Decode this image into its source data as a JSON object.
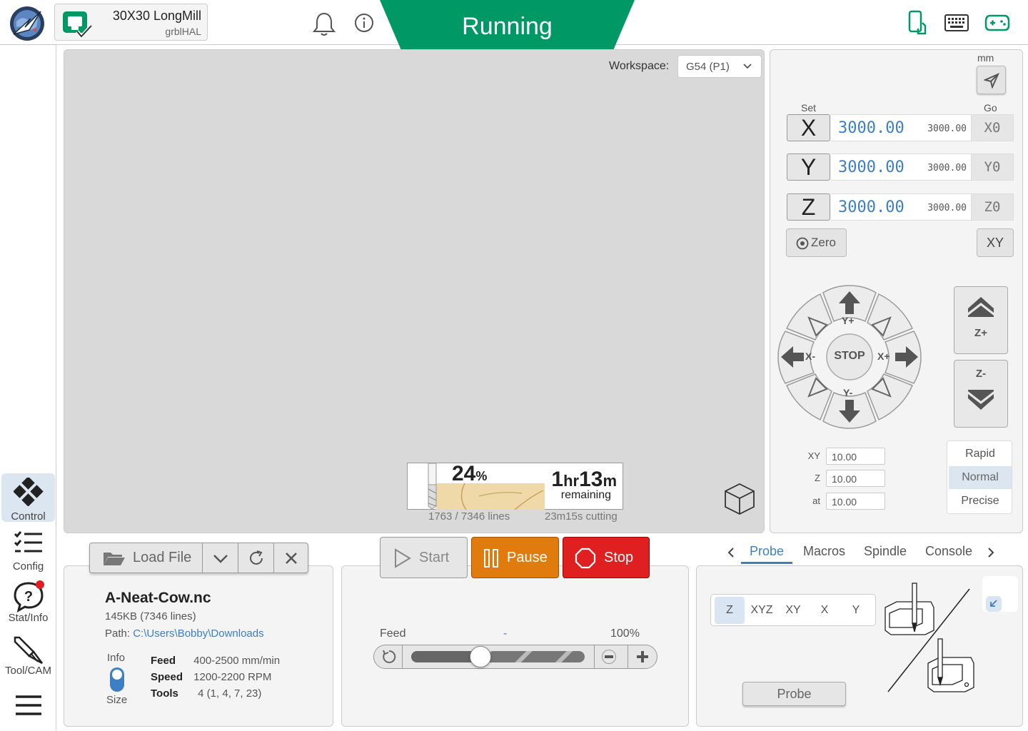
{
  "header": {
    "machine_name": "30X30 LongMill",
    "firmware": "grblHAL",
    "status": "Running",
    "colors": {
      "status_bg": "#009966",
      "accent": "#3c7fc4",
      "pause": "#e07b0e",
      "stop": "#e02020"
    },
    "icons": [
      "app-logo-icon",
      "machine-status-icon",
      "bell-icon",
      "info-icon",
      "phone-remote-icon",
      "keyboard-icon",
      "gamepad-icon"
    ]
  },
  "sidebar": {
    "items": [
      {
        "id": "control",
        "label": "Control",
        "icon": "control-icon",
        "active": true
      },
      {
        "id": "config",
        "label": "Config",
        "icon": "config-list-icon"
      },
      {
        "id": "stat-info",
        "label": "Stat/Info",
        "icon": "help-bubble-icon"
      },
      {
        "id": "tool-cam",
        "label": "Tool/CAM",
        "icon": "endmill-icon"
      }
    ],
    "menu_icon": "hamburger-icon"
  },
  "visualizer": {
    "workspace_label": "Workspace:",
    "workspace_value": "G54 (P1)",
    "progress": {
      "percent_value": "24",
      "percent_sign": "%",
      "percent_fraction": 0.24,
      "time_hr": "1",
      "time_hr_unit": "hr",
      "time_min": "13",
      "time_min_unit": "m",
      "remaining_label": "remaining",
      "lines": "1763 / 7346 lines",
      "cutting": "23m15s cutting"
    }
  },
  "dro": {
    "unit": "mm",
    "set_label": "Set",
    "go_label": "Go",
    "axes": [
      {
        "axis": "X",
        "work": "3000.00",
        "machine": "3000.00",
        "go": "X0"
      },
      {
        "axis": "Y",
        "work": "3000.00",
        "machine": "3000.00",
        "go": "Y0"
      },
      {
        "axis": "Z",
        "work": "3000.00",
        "machine": "3000.00",
        "go": "Z0"
      }
    ],
    "zero_label": "Zero",
    "xy_label": "XY"
  },
  "jog": {
    "y_plus": "Y+",
    "y_minus": "Y-",
    "x_plus": "X+",
    "x_minus": "X-",
    "stop": "STOP",
    "z_plus": "Z+",
    "z_minus": "Z-",
    "steps": [
      {
        "label": "XY",
        "value": "10.00"
      },
      {
        "label": "Z",
        "value": "10.00"
      },
      {
        "label": "at",
        "value": "10.00"
      }
    ],
    "speeds": [
      "Rapid",
      "Normal",
      "Precise"
    ],
    "selected_speed": "Normal"
  },
  "file": {
    "load_label": "Load File",
    "name": "A-Neat-Cow.nc",
    "size": "145KB (7346 lines)",
    "path_label": "Path:",
    "path": "C:\\Users\\Bobby\\Downloads",
    "toggle_top": "Info",
    "toggle_bottom": "Size",
    "feed_label": "Feed",
    "feed_value": "400-2500 mm/min",
    "speed_label": "Speed",
    "speed_value": "1200-2200 RPM",
    "tools_label": "Tools",
    "tools_value": "4 (1, 4, 7, 23)"
  },
  "run": {
    "start": "Start",
    "pause": "Pause",
    "stop": "Stop"
  },
  "feed": {
    "label": "Feed",
    "dash": "-",
    "percent": "100%",
    "slider_fraction": 0.4
  },
  "tabs": {
    "items": [
      "Probe",
      "Macros",
      "Spindle",
      "Console"
    ],
    "active": "Probe"
  },
  "probe": {
    "modes": [
      "Z",
      "XYZ",
      "XY",
      "X",
      "Y"
    ],
    "selected_mode": "Z",
    "button": "Probe"
  }
}
